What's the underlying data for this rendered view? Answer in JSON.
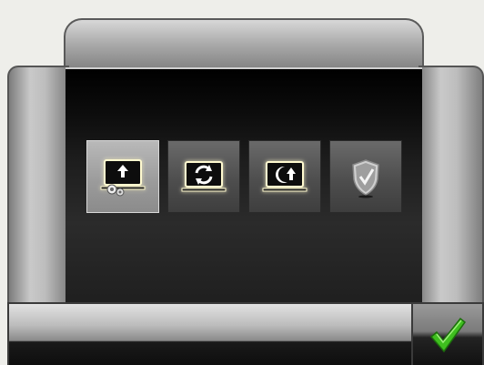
{
  "dialog": {
    "tiles": [
      {
        "icon": "screen-upload-icon",
        "selected": true
      },
      {
        "icon": "screen-refresh-icon",
        "selected": false
      },
      {
        "icon": "screen-night-mode-icon",
        "selected": false
      },
      {
        "icon": "shield-check-icon",
        "selected": false
      }
    ]
  },
  "bottom_bar": {
    "ok_icon": "checkmark-icon"
  },
  "colors": {
    "screen_bg": "#1e1e1e",
    "tile_highlight": "#fffad0",
    "checkmark": "#3fbf1f"
  }
}
